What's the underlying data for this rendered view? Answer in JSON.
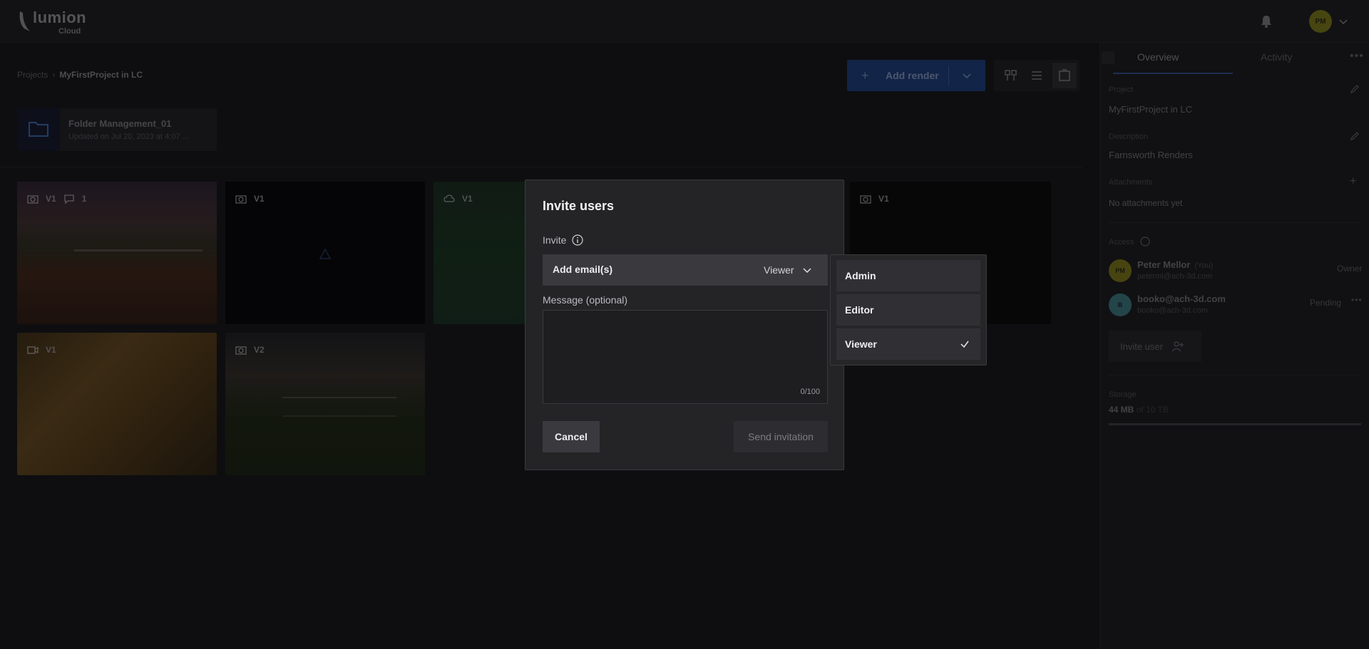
{
  "brand": {
    "name": "lumion",
    "sub": "Cloud"
  },
  "header": {
    "avatar_initials": "PM"
  },
  "breadcrumb": {
    "root": "Projects",
    "separator": "›",
    "current": "MyFirstProject in LC"
  },
  "toolbar": {
    "add_render_label": "Add render"
  },
  "folder": {
    "title": "Folder Management_01",
    "updated": "Updated on Jul 20, 2023 at 4:07 ..."
  },
  "renders": [
    {
      "version": "V1",
      "comments": "1"
    },
    {
      "version": "V1"
    },
    {
      "version": "V1"
    },
    {
      "version": "V1"
    },
    {
      "version": "V1"
    },
    {
      "version": "V2"
    }
  ],
  "panel": {
    "tabs": {
      "overview": "Overview",
      "activity": "Activity"
    },
    "project_label": "Project",
    "project_value": "MyFirstProject in LC",
    "description_label": "Description",
    "description_value": "Farnsworth Renders",
    "attachments_label": "Attachments",
    "attachments_value": "No attachments yet",
    "access_label": "Access",
    "users": [
      {
        "initials": "PM",
        "name": "Peter Mellor",
        "you": "(You)",
        "email": "petermi@ach-3d.com",
        "role": "Owner",
        "avatar_color": "#8a8418"
      },
      {
        "initials": "B",
        "name": "booko@ach-3d.com",
        "email": "booko@ach-3d.com",
        "role": "Pending",
        "avatar_color": "#4aa0a8"
      }
    ],
    "invite_user_label": "Invite user",
    "storage_label": "Storage",
    "storage_value": "44 MB",
    "storage_total": "of 10 TB"
  },
  "modal": {
    "title": "Invite users",
    "invite_label": "Invite",
    "email_placeholder": "Add email(s)",
    "role_value": "Viewer",
    "message_label": "Message (optional)",
    "message_counter": "0/100",
    "cancel_label": "Cancel",
    "send_label": "Send invitation"
  },
  "role_dropdown": {
    "options": [
      "Admin",
      "Editor",
      "Viewer"
    ],
    "selected": "Viewer"
  },
  "colors": {
    "accent": "#1e3c78",
    "modal_bg": "#242427",
    "field_bg": "#3a3a3e"
  }
}
